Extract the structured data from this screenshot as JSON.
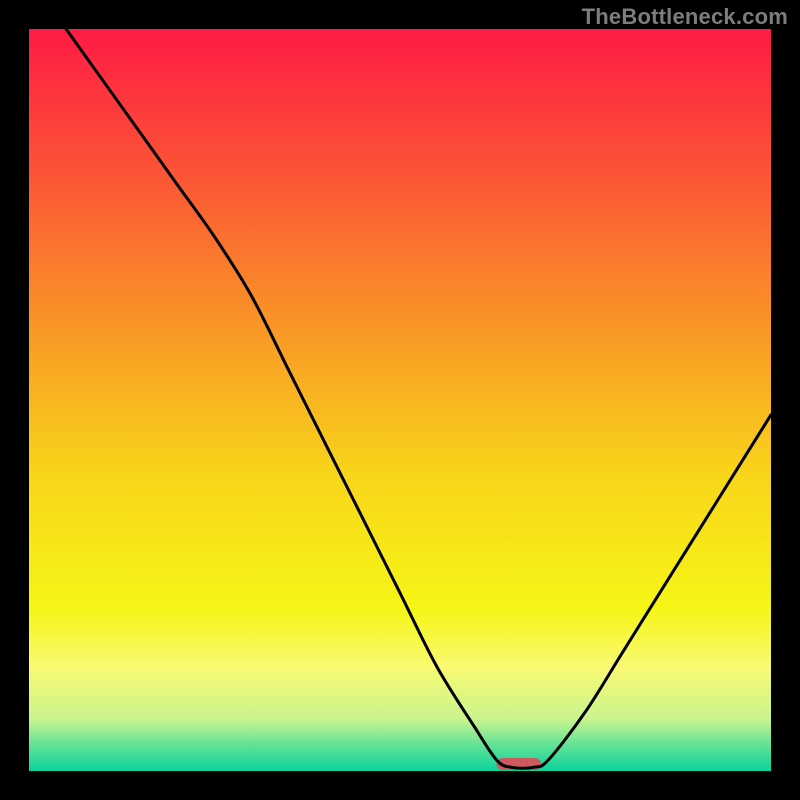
{
  "watermark": "TheBottleneck.com",
  "chart_data": {
    "type": "line",
    "title": "",
    "xlabel": "",
    "ylabel": "",
    "xlim": [
      0,
      100
    ],
    "ylim": [
      0,
      100
    ],
    "grid": false,
    "series": [
      {
        "name": "curve",
        "x": [
          5,
          10,
          15,
          20,
          25,
          30,
          35,
          40,
          45,
          50,
          55,
          60,
          63,
          65,
          68,
          70,
          75,
          80,
          85,
          90,
          95,
          100
        ],
        "y": [
          100,
          93,
          86,
          79,
          72,
          64,
          54,
          44,
          34,
          24,
          14,
          6,
          1.5,
          0.5,
          0.5,
          1.5,
          8,
          16,
          24,
          32,
          40,
          48
        ]
      }
    ],
    "marker": {
      "name": "optimal-marker",
      "x_start": 63,
      "x_end": 69,
      "color": "#cc5a5f"
    },
    "gradient_stops": [
      {
        "offset": 0.0,
        "color": "#fe1b44"
      },
      {
        "offset": 0.2,
        "color": "#fb5635"
      },
      {
        "offset": 0.4,
        "color": "#f99626"
      },
      {
        "offset": 0.6,
        "color": "#f8d51a"
      },
      {
        "offset": 0.78,
        "color": "#f6f516"
      },
      {
        "offset": 0.86,
        "color": "#f9fa72"
      },
      {
        "offset": 0.93,
        "color": "#c9f48e"
      },
      {
        "offset": 0.965,
        "color": "#62e296"
      },
      {
        "offset": 1.0,
        "color": "#0bd39c"
      }
    ]
  }
}
